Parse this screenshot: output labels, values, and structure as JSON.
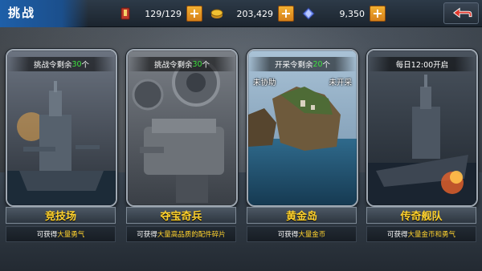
{
  "header": {
    "title": "挑战",
    "resources": [
      {
        "icon": "stamina-icon",
        "value": "129/129"
      },
      {
        "icon": "gold-coins-icon",
        "value": "203,429"
      },
      {
        "icon": "diamond-icon",
        "value": "9,350"
      }
    ],
    "plus_label": "+"
  },
  "cards": [
    {
      "header_pre": "挑战令剩余",
      "header_count": "30",
      "header_post": "个",
      "name": "竞技场",
      "desc_pre": "可获得",
      "desc_hl": "大量勇气",
      "desc_post": ""
    },
    {
      "header_pre": "挑战令剩余",
      "header_count": "30",
      "header_post": "个",
      "name": "夺宝奇兵",
      "desc_pre": "可获得",
      "desc_hl": "大量高品质的配件碎片",
      "desc_post": ""
    },
    {
      "header_pre": "开采令剩余",
      "header_count": "20",
      "header_post": "个",
      "tag_left": "未协助",
      "tag_right": "未开采",
      "name": "黄金岛",
      "desc_pre": "可获得",
      "desc_hl": "大量金币",
      "desc_post": ""
    },
    {
      "header_pre": "每日12:00开启",
      "header_count": "",
      "header_post": "",
      "name": "传奇舰队",
      "desc_pre": "可获得",
      "desc_hl": "大量金币和勇气",
      "desc_post": ""
    }
  ],
  "colors": {
    "accent_yellow": "#ffd22e",
    "count_green": "#3ee23e",
    "title_blue": "#1e5fa8",
    "plus_orange": "#f2b032"
  }
}
